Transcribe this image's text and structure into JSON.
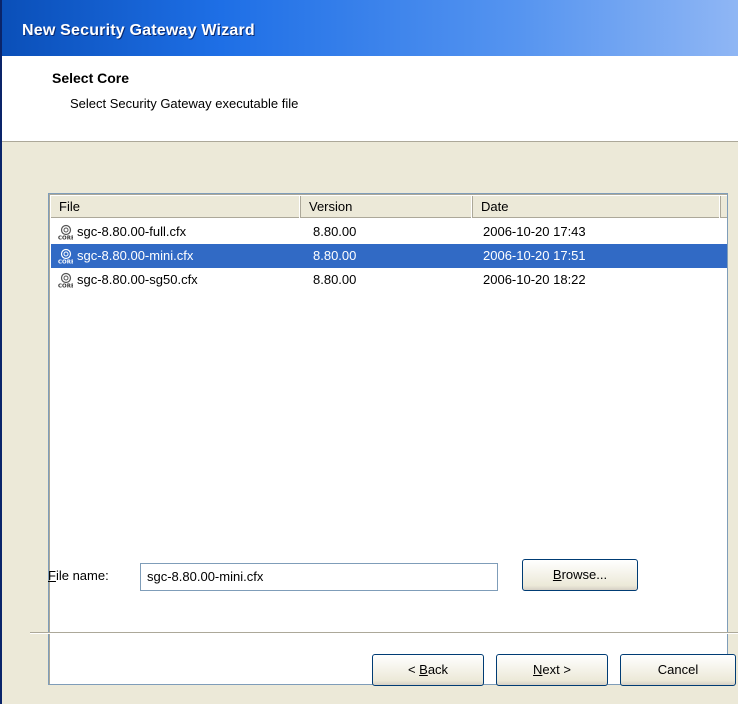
{
  "window": {
    "title": "New Security Gateway Wizard"
  },
  "header": {
    "title": "Select Core",
    "subtitle": "Select Security Gateway executable file"
  },
  "file_list": {
    "columns": [
      "File",
      "Version",
      "Date"
    ],
    "rows": [
      {
        "file": "sgc-8.80.00-full.cfx",
        "version": "8.80.00",
        "date": "2006-10-20 17:43",
        "selected": false
      },
      {
        "file": "sgc-8.80.00-mini.cfx",
        "version": "8.80.00",
        "date": "2006-10-20 17:51",
        "selected": true
      },
      {
        "file": "sgc-8.80.00-sg50.cfx",
        "version": "8.80.00",
        "date": "2006-10-20 18:22",
        "selected": false
      }
    ],
    "row_icon": "core-file-icon"
  },
  "file_name": {
    "label_first": "F",
    "label_rest": "ile name:",
    "value": "sgc-8.80.00-mini.cfx"
  },
  "buttons": {
    "browse_u": "B",
    "browse_rest": "rowse...",
    "back_prefix": "< ",
    "back_u": "B",
    "back_rest": "ack",
    "next_u": "N",
    "next_rest": "ext >",
    "cancel": "Cancel"
  },
  "colors": {
    "selection": "#316ac5",
    "title_bar": "#1e6fe6",
    "dialog_bg": "#ece9d8"
  }
}
